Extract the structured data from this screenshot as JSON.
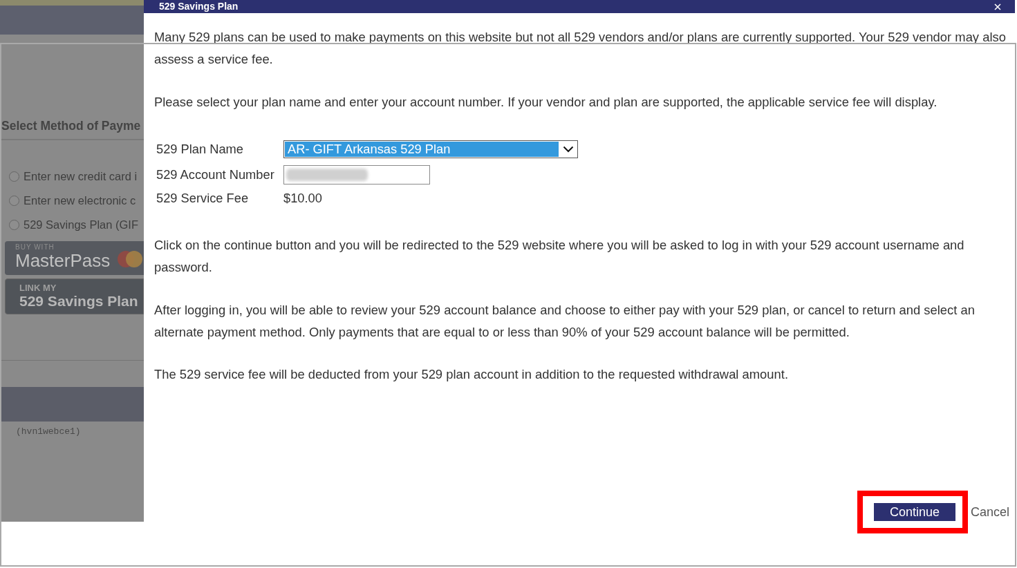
{
  "background_page": {
    "heading": "Select Method of Payme",
    "payment_options": [
      {
        "label": "Enter new credit card i",
        "selected": false
      },
      {
        "label": "Enter new electronic c",
        "selected": false
      },
      {
        "label": "529 Savings Plan (GIF",
        "selected": false
      }
    ],
    "wallet_button": {
      "caption": "BUY WITH",
      "label": "MasterPass"
    },
    "link_button": {
      "caption": "LINK MY",
      "label": "529 Savings Plan"
    },
    "footer_text": "(hvn1webce1)"
  },
  "dialog": {
    "title": "529 Savings Plan",
    "paragraphs_top": [
      "Many 529 plans can be used to make payments on this website but not all 529 vendors and/or plans are currently supported. Your 529 vendor may also assess a service fee.",
      "Please select your plan name and enter your account number. If your vendor and plan are supported, the applicable service fee will display."
    ],
    "form": {
      "fields": [
        {
          "label": "529 Plan Name",
          "kind": "select",
          "value": "AR- GIFT Arkansas 529 Plan",
          "focused": true
        },
        {
          "label": "529 Account Number",
          "kind": "input",
          "redacted": true
        },
        {
          "label": "529 Service Fee",
          "kind": "text",
          "value": "$10.00"
        }
      ]
    },
    "paragraphs_bottom": [
      "Click on the continue button and you will be redirected to the 529 website where you will be asked to log in with your 529 account username and password.",
      "After logging in, you will be able to review your 529 account balance and choose to either pay with your 529 plan, or cancel to return and select an alternate payment method. Only payments that are equal to or less than 90% of your 529 account balance will be permitted.",
      "The 529 service fee will be deducted from your 529 plan account in addition to the requested withdrawal amount."
    ],
    "buttons": [
      {
        "label": "Continue",
        "kind": "primary",
        "highlighted": true
      },
      {
        "label": "Cancel",
        "kind": "link",
        "highlighted": false
      }
    ]
  }
}
